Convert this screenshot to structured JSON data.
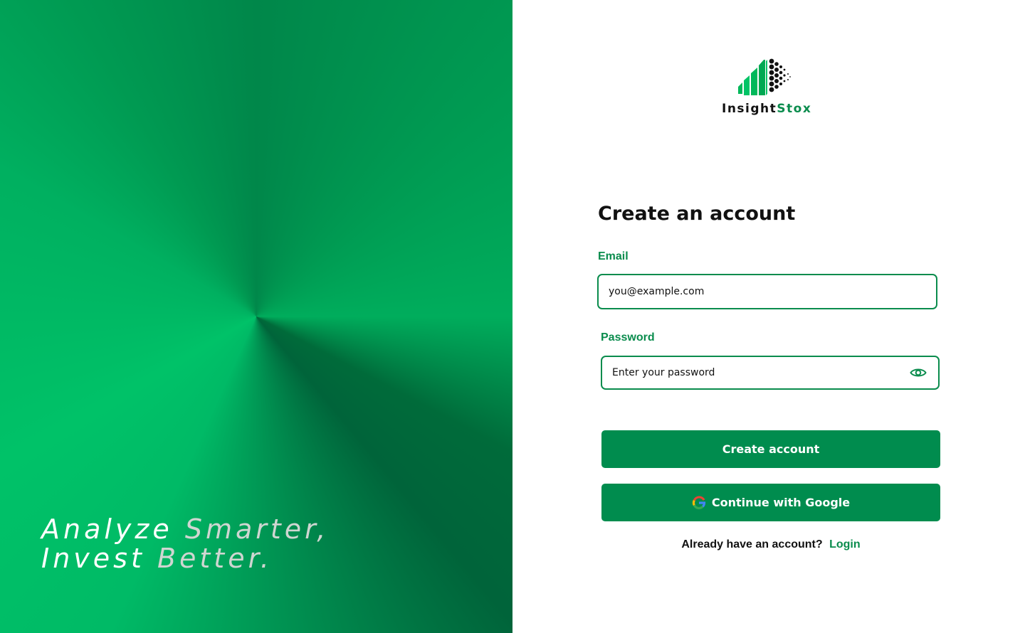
{
  "brand": {
    "name_part1": "Insight",
    "name_part2": "Stox",
    "primary_color": "#008c4e",
    "accent_text_color": "#0a8c4d"
  },
  "hero": {
    "line1_word1": "Analyze",
    "line1_word2": "Smarter,",
    "line2_word1": "Invest",
    "line2_word2": "Better."
  },
  "form": {
    "title": "Create an account",
    "email": {
      "label": "Email",
      "placeholder": "you@example.com",
      "value": ""
    },
    "password": {
      "label": "Password",
      "placeholder": "Enter your password",
      "value": "",
      "icon": "eye-icon"
    },
    "create_button": "Create account",
    "google_button": "Continue with Google",
    "google_icon": "google-icon",
    "login_prompt": "Already have an account?",
    "login_link": "Login"
  }
}
